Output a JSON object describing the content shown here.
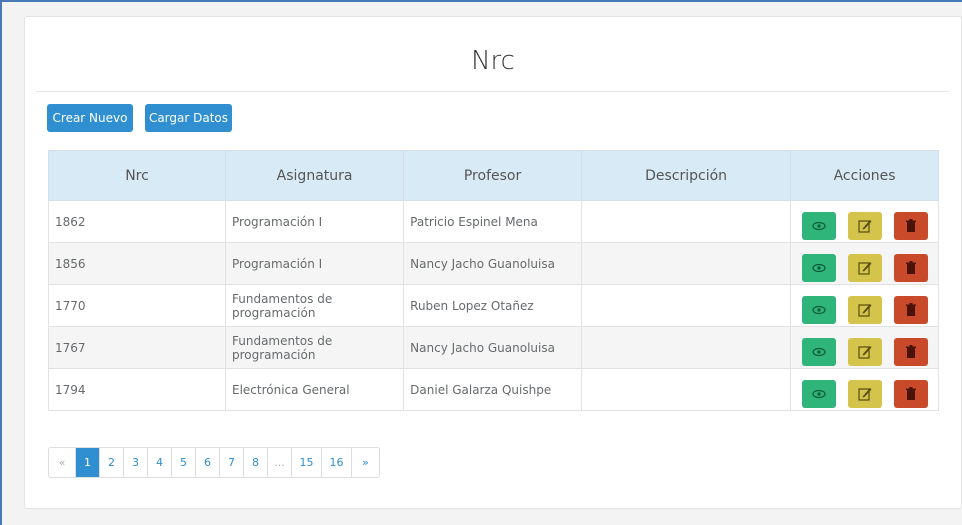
{
  "page": {
    "title": "Nrc",
    "create_label": "Crear Nuevo",
    "load_label": "Cargar Datos"
  },
  "table": {
    "headers": [
      "Nrc",
      "Asignatura",
      "Profesor",
      "Descripción",
      "Acciones"
    ],
    "rows": [
      {
        "nrc": "1862",
        "asignatura": "Programación I",
        "profesor": "Patricio Espinel Mena",
        "descripcion": ""
      },
      {
        "nrc": "1856",
        "asignatura": "Programación I",
        "profesor": "Nancy Jacho Guanoluisa",
        "descripcion": ""
      },
      {
        "nrc": "1770",
        "asignatura": "Fundamentos de programación",
        "profesor": "Ruben Lopez Otañez",
        "descripcion": ""
      },
      {
        "nrc": "1767",
        "asignatura": "Fundamentos de programación",
        "profesor": "Nancy Jacho Guanoluisa",
        "descripcion": ""
      },
      {
        "nrc": "1794",
        "asignatura": "Electrónica General",
        "profesor": "Daniel Galarza Quishpe",
        "descripcion": ""
      }
    ]
  },
  "actions": {
    "view_icon": "eye-icon",
    "edit_icon": "edit-icon",
    "delete_icon": "trash-icon",
    "colors": {
      "view": "#2fb47a",
      "edit": "#d4c44c",
      "delete": "#c94a2a"
    }
  },
  "pagination": {
    "prev": "«",
    "pages": [
      "1",
      "2",
      "3",
      "4",
      "5",
      "6",
      "7",
      "8",
      "...",
      "15",
      "16"
    ],
    "next": "»",
    "active": "1"
  },
  "colors": {
    "primary": "#2f8fd1",
    "header_bg": "#d9eaf7"
  }
}
